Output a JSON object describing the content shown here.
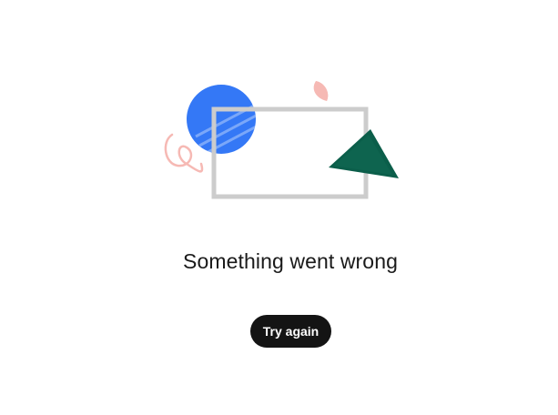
{
  "error": {
    "title": "Something went wrong",
    "retry_label": "Try again"
  },
  "illustration": {
    "icon": "broken-content-illustration",
    "colors": {
      "circle": "#3478f6",
      "frame": "#cccccc",
      "triangle": "#0b5e4a",
      "accent": "#f6b9b4"
    }
  },
  "theme": {
    "button_bg": "#141414",
    "button_text": "#ffffff",
    "text": "#1a1a1a"
  }
}
